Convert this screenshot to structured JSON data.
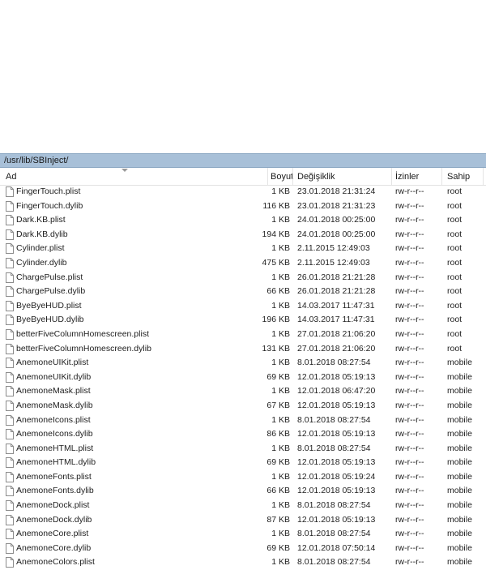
{
  "path": "/usr/lib/SBInject/",
  "columns": {
    "name": "Ad",
    "size": "Boyut",
    "modified": "Değişiklik",
    "permissions": "İzinler",
    "owner": "Sahip"
  },
  "files": [
    {
      "name": "FingerTouch.plist",
      "size": "1 KB",
      "modified": "23.01.2018 21:31:24",
      "permissions": "rw-r--r--",
      "owner": "root"
    },
    {
      "name": "FingerTouch.dylib",
      "size": "116 KB",
      "modified": "23.01.2018 21:31:23",
      "permissions": "rw-r--r--",
      "owner": "root"
    },
    {
      "name": "Dark.KB.plist",
      "size": "1 KB",
      "modified": "24.01.2018 00:25:00",
      "permissions": "rw-r--r--",
      "owner": "root"
    },
    {
      "name": "Dark.KB.dylib",
      "size": "194 KB",
      "modified": "24.01.2018 00:25:00",
      "permissions": "rw-r--r--",
      "owner": "root"
    },
    {
      "name": "Cylinder.plist",
      "size": "1 KB",
      "modified": "2.11.2015 12:49:03",
      "permissions": "rw-r--r--",
      "owner": "root"
    },
    {
      "name": "Cylinder.dylib",
      "size": "475 KB",
      "modified": "2.11.2015 12:49:03",
      "permissions": "rw-r--r--",
      "owner": "root"
    },
    {
      "name": "ChargePulse.plist",
      "size": "1 KB",
      "modified": "26.01.2018 21:21:28",
      "permissions": "rw-r--r--",
      "owner": "root"
    },
    {
      "name": "ChargePulse.dylib",
      "size": "66 KB",
      "modified": "26.01.2018 21:21:28",
      "permissions": "rw-r--r--",
      "owner": "root"
    },
    {
      "name": "ByeByeHUD.plist",
      "size": "1 KB",
      "modified": "14.03.2017 11:47:31",
      "permissions": "rw-r--r--",
      "owner": "root"
    },
    {
      "name": "ByeByeHUD.dylib",
      "size": "196 KB",
      "modified": "14.03.2017 11:47:31",
      "permissions": "rw-r--r--",
      "owner": "root"
    },
    {
      "name": "betterFiveColumnHomescreen.plist",
      "size": "1 KB",
      "modified": "27.01.2018 21:06:20",
      "permissions": "rw-r--r--",
      "owner": "root"
    },
    {
      "name": "betterFiveColumnHomescreen.dylib",
      "size": "131 KB",
      "modified": "27.01.2018 21:06:20",
      "permissions": "rw-r--r--",
      "owner": "root"
    },
    {
      "name": "AnemoneUIKit.plist",
      "size": "1 KB",
      "modified": "8.01.2018 08:27:54",
      "permissions": "rw-r--r--",
      "owner": "mobile"
    },
    {
      "name": "AnemoneUIKit.dylib",
      "size": "69 KB",
      "modified": "12.01.2018 05:19:13",
      "permissions": "rw-r--r--",
      "owner": "mobile"
    },
    {
      "name": "AnemoneMask.plist",
      "size": "1 KB",
      "modified": "12.01.2018 06:47:20",
      "permissions": "rw-r--r--",
      "owner": "mobile"
    },
    {
      "name": "AnemoneMask.dylib",
      "size": "67 KB",
      "modified": "12.01.2018 05:19:13",
      "permissions": "rw-r--r--",
      "owner": "mobile"
    },
    {
      "name": "AnemoneIcons.plist",
      "size": "1 KB",
      "modified": "8.01.2018 08:27:54",
      "permissions": "rw-r--r--",
      "owner": "mobile"
    },
    {
      "name": "AnemoneIcons.dylib",
      "size": "86 KB",
      "modified": "12.01.2018 05:19:13",
      "permissions": "rw-r--r--",
      "owner": "mobile"
    },
    {
      "name": "AnemoneHTML.plist",
      "size": "1 KB",
      "modified": "8.01.2018 08:27:54",
      "permissions": "rw-r--r--",
      "owner": "mobile"
    },
    {
      "name": "AnemoneHTML.dylib",
      "size": "69 KB",
      "modified": "12.01.2018 05:19:13",
      "permissions": "rw-r--r--",
      "owner": "mobile"
    },
    {
      "name": "AnemoneFonts.plist",
      "size": "1 KB",
      "modified": "12.01.2018 05:19:24",
      "permissions": "rw-r--r--",
      "owner": "mobile"
    },
    {
      "name": "AnemoneFonts.dylib",
      "size": "66 KB",
      "modified": "12.01.2018 05:19:13",
      "permissions": "rw-r--r--",
      "owner": "mobile"
    },
    {
      "name": "AnemoneDock.plist",
      "size": "1 KB",
      "modified": "8.01.2018 08:27:54",
      "permissions": "rw-r--r--",
      "owner": "mobile"
    },
    {
      "name": "AnemoneDock.dylib",
      "size": "87 KB",
      "modified": "12.01.2018 05:19:13",
      "permissions": "rw-r--r--",
      "owner": "mobile"
    },
    {
      "name": "AnemoneCore.plist",
      "size": "1 KB",
      "modified": "8.01.2018 08:27:54",
      "permissions": "rw-r--r--",
      "owner": "mobile"
    },
    {
      "name": "AnemoneCore.dylib",
      "size": "69 KB",
      "modified": "12.01.2018 07:50:14",
      "permissions": "rw-r--r--",
      "owner": "mobile"
    },
    {
      "name": "AnemoneColors.plist",
      "size": "1 KB",
      "modified": "8.01.2018 08:27:54",
      "permissions": "rw-r--r--",
      "owner": "mobile"
    }
  ],
  "icons": {
    "file": "file-icon"
  },
  "colors": {
    "path_bar": "#a8c0d8"
  }
}
